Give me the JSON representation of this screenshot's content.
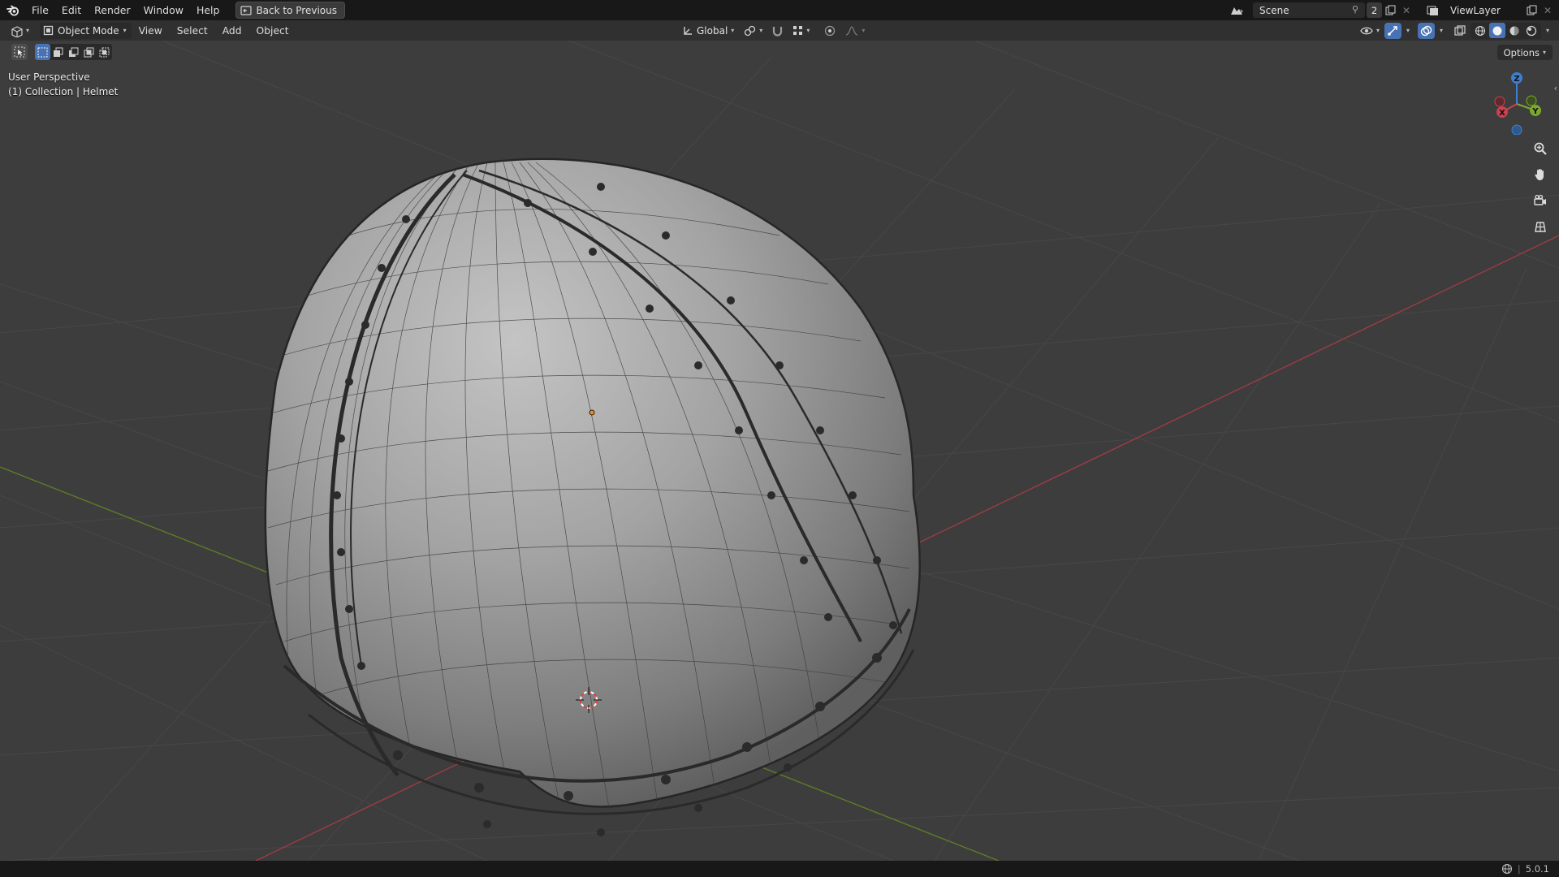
{
  "menubar": {
    "items": [
      "File",
      "Edit",
      "Render",
      "Window",
      "Help"
    ],
    "back_button": "Back to Previous",
    "scene_name": "Scene",
    "scene_users": "2",
    "view_layer": "ViewLayer"
  },
  "header": {
    "mode": "Object Mode",
    "menus": [
      "View",
      "Select",
      "Add",
      "Object"
    ],
    "transform_orientation": "Global",
    "options_label": "Options"
  },
  "viewport": {
    "view_name": "User Perspective",
    "collection_info": "(1) Collection | Helmet",
    "gizmo": {
      "x_label": "X",
      "y_label": "Y",
      "z_label": "Z"
    }
  },
  "statusbar": {
    "version": "5.0.1"
  },
  "colors": {
    "x_axis": "#c9424e",
    "y_axis": "#7aa82f",
    "z_axis": "#3d7fd0",
    "accent": "#4772b3"
  }
}
